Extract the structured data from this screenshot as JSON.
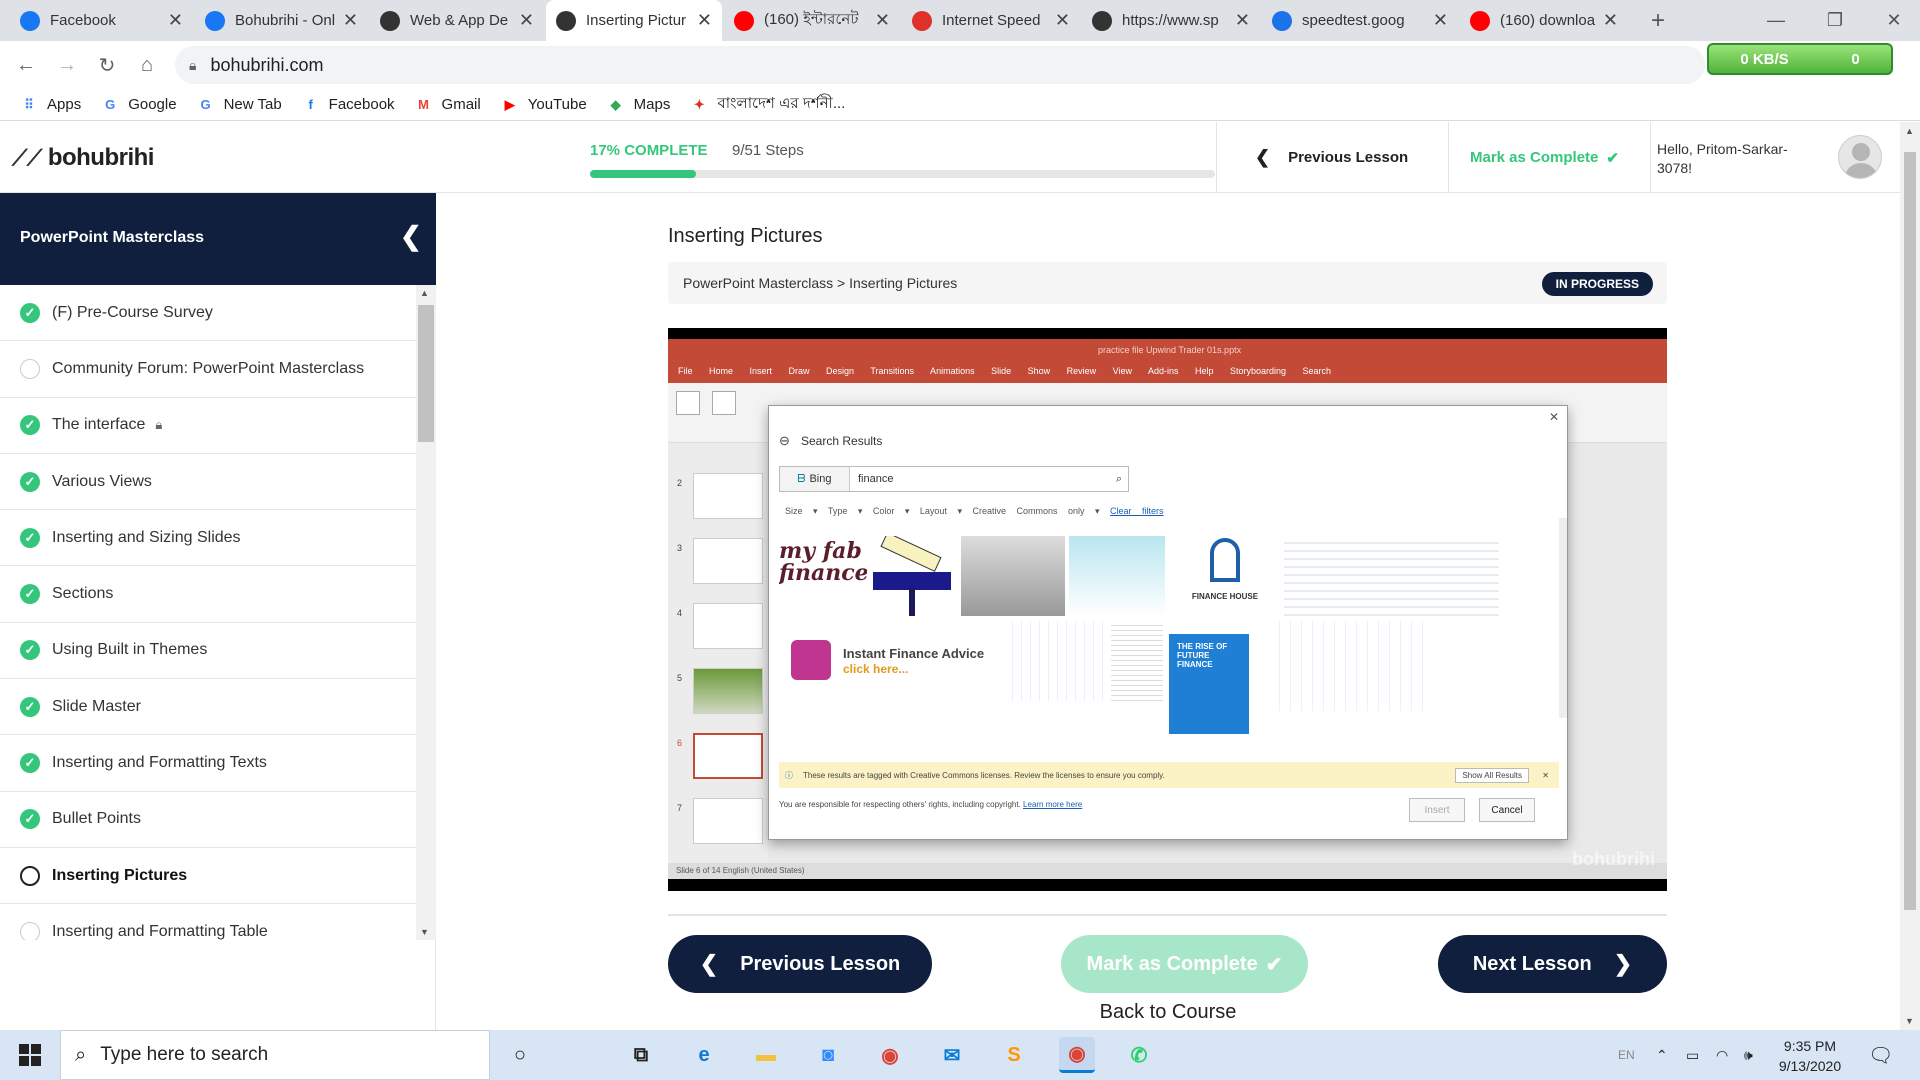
{
  "browser": {
    "tabs": [
      {
        "title": "Facebook",
        "icon": "facebook-icon",
        "color": "#1877f2"
      },
      {
        "title": "Bohubrihi - Onl",
        "icon": "facebook-icon",
        "color": "#1877f2"
      },
      {
        "title": "Web & App De",
        "icon": "bohubrihi-icon",
        "color": "#333333"
      },
      {
        "title": "Inserting Pictur",
        "icon": "bohubrihi-icon",
        "color": "#333333"
      },
      {
        "title": "(160) ইন্টারনেট",
        "icon": "youtube-icon",
        "color": "#ff0000"
      },
      {
        "title": "Internet Speed",
        "icon": "speedtest-icon",
        "color": "#e0302a"
      },
      {
        "title": "https://www.sp",
        "icon": "speedometer-icon",
        "color": "#333333"
      },
      {
        "title": "speedtest.goog",
        "icon": "fiber-icon",
        "color": "#1a73e8"
      },
      {
        "title": "(160) downloa",
        "icon": "youtube-icon",
        "color": "#ff0000"
      }
    ],
    "url": "bohubrihi.com",
    "net_widget": {
      "speed": "0 KB/S",
      "count": "0"
    },
    "bookmarks": [
      {
        "label": "Apps",
        "icon": "apps-grid-icon",
        "color": "#4285f4"
      },
      {
        "label": "Google",
        "icon": "google-icon",
        "color": "#4285f4"
      },
      {
        "label": "New Tab",
        "icon": "google-icon",
        "color": "#4285f4"
      },
      {
        "label": "Facebook",
        "icon": "facebook-icon",
        "color": "#1877f2"
      },
      {
        "label": "Gmail",
        "icon": "gmail-icon",
        "color": "#ea4335"
      },
      {
        "label": "YouTube",
        "icon": "youtube-icon",
        "color": "#ff0000"
      },
      {
        "label": "Maps",
        "icon": "maps-icon",
        "color": "#34a853"
      },
      {
        "label": "বাংলাদেশ এর দর্শনী...",
        "icon": "bangladesh-site-icon",
        "color": "#d93025"
      }
    ]
  },
  "site": {
    "logo_text": "bohubrihi",
    "progress": {
      "percent_label": "17% COMPLETE",
      "steps_label": "9/51 Steps",
      "fraction": 0.17
    },
    "top_prev_label": "Previous Lesson",
    "top_mark_label": "Mark as Complete",
    "greeting": "Hello, Pritom-Sarkar-3078!",
    "course_title": "PowerPoint Masterclass",
    "lessons": [
      {
        "label": "(F) Pre-Course Survey",
        "status": "done"
      },
      {
        "label": "Community Forum: PowerPoint Masterclass",
        "status": "todo"
      },
      {
        "label": "The interface",
        "status": "done",
        "locked": true
      },
      {
        "label": "Various Views",
        "status": "done"
      },
      {
        "label": "Inserting and Sizing Slides",
        "status": "done"
      },
      {
        "label": "Sections",
        "status": "done"
      },
      {
        "label": "Using Built in Themes",
        "status": "done"
      },
      {
        "label": "Slide Master",
        "status": "done"
      },
      {
        "label": "Inserting and Formatting Texts",
        "status": "done"
      },
      {
        "label": "Bullet Points",
        "status": "done"
      },
      {
        "label": "Inserting Pictures",
        "status": "current"
      },
      {
        "label": "Inserting and Formatting Table",
        "status": "todo"
      }
    ],
    "lesson_title": "Inserting Pictures",
    "breadcrumb": "PowerPoint Masterclass > Inserting Pictures",
    "status_badge": "IN PROGRESS",
    "video": {
      "ppt_title": "practice file Upwind Trader 01s.pptx",
      "ppt_tabs": "File Home Insert Draw Design Transitions Animations Slide Show Review View Add-ins Help Storyboarding Search",
      "dialog_title": "Search Results",
      "search_provider": "Bing",
      "search_query": "finance",
      "filters": "Size ▾ Type ▾ Color ▾ Layout ▾ Creative Commons only ▾",
      "clear_filters": "Clear filters",
      "notice": "These results are tagged with Creative Commons licenses. Review the licenses to ensure you comply.",
      "show_all": "Show All Results",
      "responsibility": "You are responsible for respecting others' rights, including copyright.",
      "learn_more": "Learn more here",
      "insert_label": "Insert",
      "cancel_label": "Cancel",
      "status_line": "Slide 6 of 14   English (United States)",
      "watermark": "bohubrihi"
    },
    "buttons": {
      "previous": "Previous Lesson",
      "mark_complete": "Mark as Complete",
      "next": "Next Lesson",
      "back": "Back to Course"
    },
    "colors": {
      "navy": "#0f1f3d",
      "green": "#34c77b",
      "green_light": "#a8e6c9"
    }
  },
  "taskbar": {
    "search_placeholder": "Type here to search",
    "apps": [
      {
        "name": "cortana-icon",
        "glyph": "○",
        "color": "#222222"
      },
      {
        "name": "task-view-icon",
        "glyph": "⧉",
        "color": "#222222"
      },
      {
        "name": "edge-icon",
        "glyph": "e",
        "color": "#0a7cd6"
      },
      {
        "name": "file-explorer-icon",
        "glyph": "▬",
        "color": "#f3c23d"
      },
      {
        "name": "zoom-icon",
        "glyph": "◙",
        "color": "#2d8cff"
      },
      {
        "name": "chrome-icon",
        "glyph": "◉",
        "color": "#db4437"
      },
      {
        "name": "mail-icon",
        "glyph": "✉",
        "color": "#0a7cd6"
      },
      {
        "name": "sublime-text-icon",
        "glyph": "S",
        "color": "#ff9800"
      },
      {
        "name": "chrome-profile-icon",
        "glyph": "◉",
        "color": "#db4437"
      },
      {
        "name": "whatsapp-icon",
        "glyph": "✆",
        "color": "#25d366"
      }
    ],
    "tray_lang": "EN",
    "time": "9:35 PM",
    "date": "9/13/2020"
  }
}
